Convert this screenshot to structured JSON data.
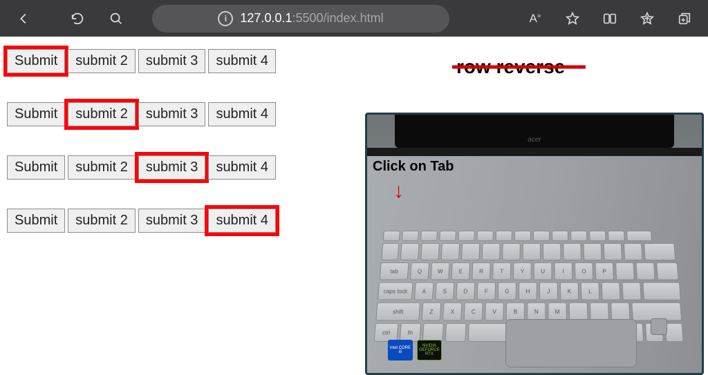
{
  "toolbar": {
    "url_host": "127.0.0.1",
    "url_port": ":5500",
    "url_path": "/index.html",
    "read_aloud_label": "A"
  },
  "page": {
    "rows": [
      {
        "buttons": [
          "Submit",
          "submit 2",
          "submit 3",
          "submit 4"
        ],
        "highlighted": 0
      },
      {
        "buttons": [
          "Submit",
          "submit 2",
          "submit 3",
          "submit 4"
        ],
        "highlighted": 1
      },
      {
        "buttons": [
          "Submit",
          "submit 2",
          "submit 3",
          "submit 4"
        ],
        "highlighted": 2
      },
      {
        "buttons": [
          "Submit",
          "submit 2",
          "submit 3",
          "submit 4"
        ],
        "highlighted": 3
      }
    ],
    "strike_text": "row reverse",
    "laptop": {
      "label": "Click on Tab",
      "brand": "acer",
      "stickers": {
        "intel": "intel CORE i5",
        "nvidia": "NVIDIA GEFORCE RTX"
      },
      "key_labels": {
        "tab": "tab",
        "caps": "caps lock",
        "shift": "shift",
        "ctrl": "ctrl",
        "fn": "fn",
        "letters_row1": [
          "Q",
          "W",
          "E",
          "R",
          "T",
          "Y",
          "U",
          "I",
          "O",
          "P"
        ],
        "letters_row2": [
          "A",
          "S",
          "D",
          "F",
          "G",
          "H",
          "J",
          "K",
          "L"
        ],
        "letters_row3": [
          "Z",
          "X",
          "C",
          "V",
          "B",
          "N",
          "M"
        ]
      }
    }
  }
}
